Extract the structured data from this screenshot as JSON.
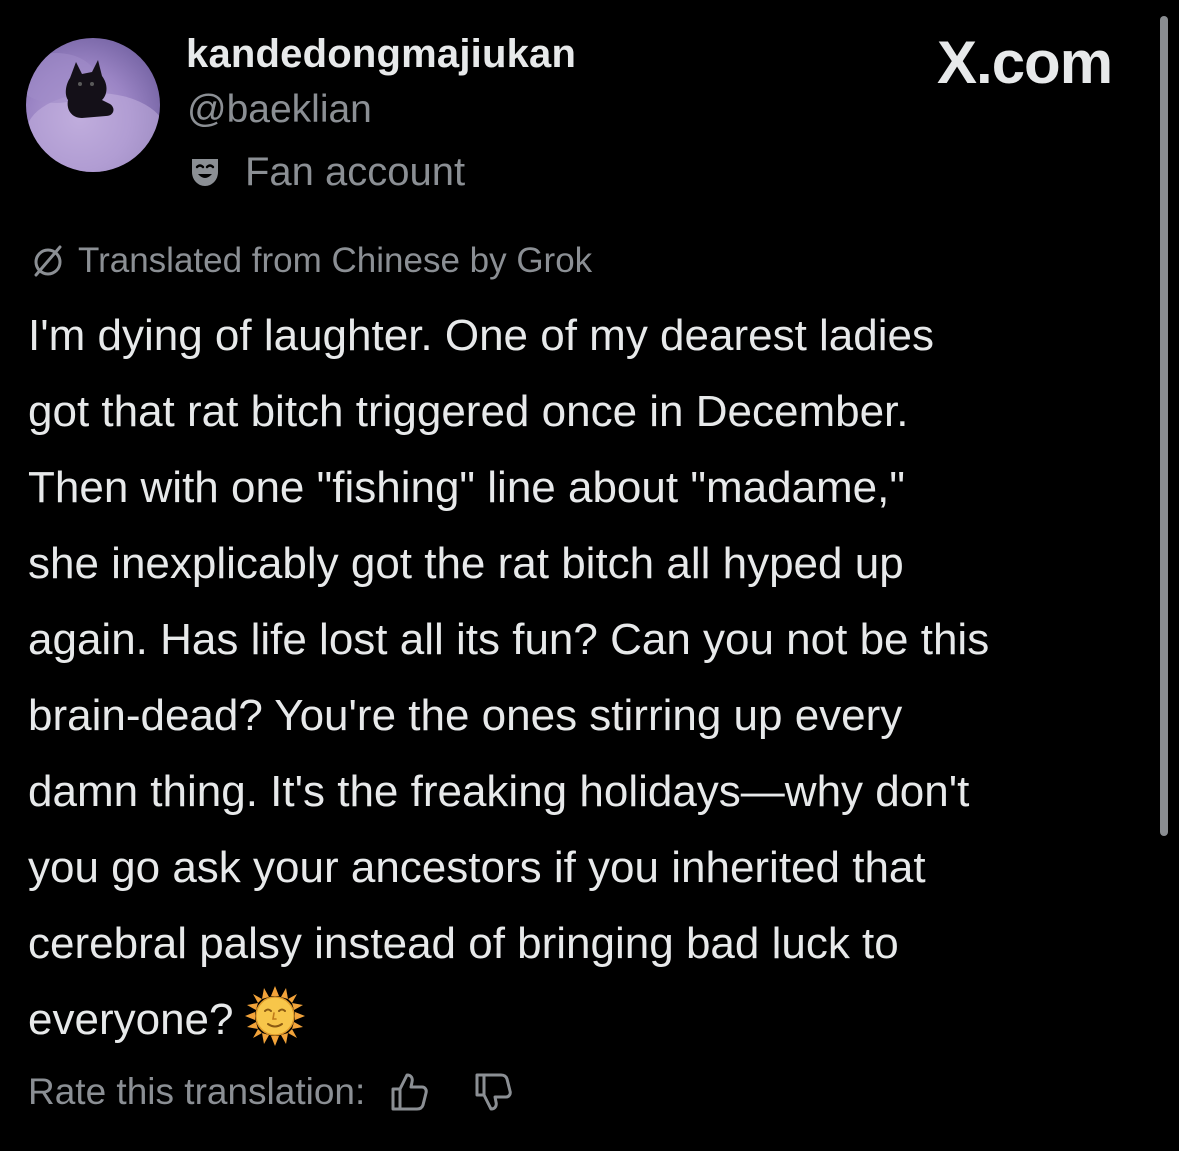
{
  "header": {
    "display_name": "kandedongmajiukan",
    "handle": "@baeklian",
    "badge_icon": "theater-mask-icon",
    "badge_label": "Fan account",
    "watermark": "X.com"
  },
  "translation": {
    "icon": "grok-icon",
    "notice": "Translated from Chinese by Grok"
  },
  "post": {
    "lines": [
      "I'm dying of laughter. One of my dearest ladies",
      "got that rat bitch triggered once in December.",
      "Then with one \"fishing\" line about \"madame,\"",
      "she inexplicably got the rat bitch all hyped up",
      "again. Has life lost all its fun? Can you not be this",
      "brain-dead? You're the ones stirring up every",
      "damn thing. It's the freaking holidays—why don't",
      "you go ask your ancestors if you inherited that",
      "cerebral palsy instead of bringing bad luck to",
      "everyone?"
    ],
    "trailing_emoji": "sun-with-face-emoji"
  },
  "rating": {
    "label": "Rate this translation:",
    "thumbs_up_icon": "thumbs-up-icon",
    "thumbs_down_icon": "thumbs-down-icon"
  },
  "colors": {
    "background": "#000000",
    "primary_text": "#e7e9ea",
    "secondary_text": "#8b8f94",
    "avatar_tint": "#9a84c4"
  }
}
